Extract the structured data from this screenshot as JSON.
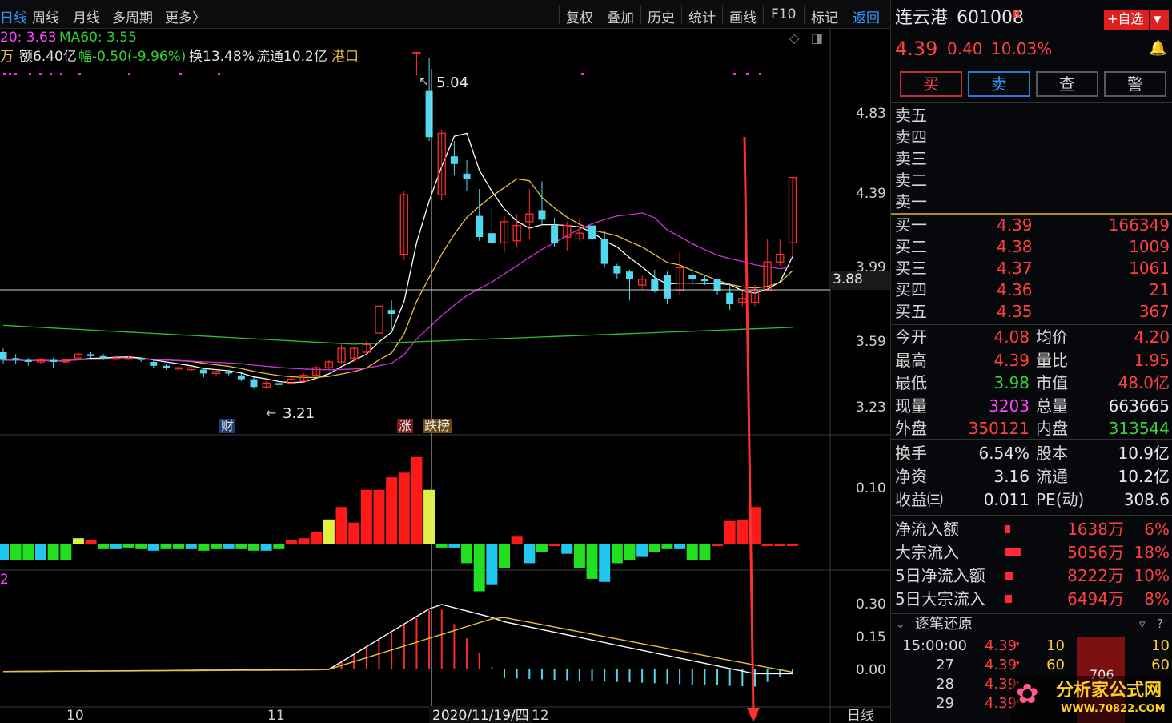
{
  "toolbar": {
    "tabs": [
      "日线",
      "周线",
      "月线",
      "多周期",
      "更多〉"
    ],
    "tools": [
      "复权",
      "叠加",
      "历史",
      "统计",
      "画线",
      "F10",
      "标记",
      "返回"
    ]
  },
  "info_line1": {
    "ma20": "20: 3.63",
    "ma60": "MA60: 3.55"
  },
  "info_line2": {
    "unit": "万",
    "amount": "额6.40亿",
    "change": "幅-0.50(-9.96%)",
    "turnover": "换13.48%",
    "float": "流通10.2亿",
    "sector": "港口"
  },
  "price_axis": [
    "4.83",
    "4.39",
    "3.99",
    "3.59",
    "3.23"
  ],
  "cursor_price": "3.88",
  "vol_axis": [
    "0.10"
  ],
  "macd_axis": [
    "0.30",
    "0.15",
    "0.00"
  ],
  "macd_label": "2",
  "annotations": {
    "high": "5.04",
    "low": "3.21",
    "tag_cai": "财",
    "tag_zhang": "涨",
    "tag_bang": "跌榜"
  },
  "date_axis": {
    "m10": "10",
    "m11": "11",
    "cursor_date": "2020/11/19/四",
    "m12": "12",
    "period": "日线"
  },
  "colors": {
    "up": "#ff2a2a",
    "down": "#4fd8f0",
    "ma5": "#ffffff",
    "ma10": "#e8c040",
    "ma20": "#d030e0",
    "ma60": "#30c030"
  },
  "stock": {
    "name": "连云港",
    "code": "601008",
    "badge": "R",
    "price": "4.39",
    "change": "0.40",
    "pct": "10.03%",
    "watch_button": "+自选"
  },
  "trade_buttons": [
    "买",
    "卖",
    "查",
    "警"
  ],
  "sells": [
    "卖五",
    "卖四",
    "卖三",
    "卖二",
    "卖一"
  ],
  "buys": [
    {
      "label": "买一",
      "price": "4.39",
      "vol": "166349"
    },
    {
      "label": "买二",
      "price": "4.38",
      "vol": "1009"
    },
    {
      "label": "买三",
      "price": "4.37",
      "vol": "1061"
    },
    {
      "label": "买四",
      "price": "4.36",
      "vol": "21"
    },
    {
      "label": "买五",
      "price": "4.35",
      "vol": "367"
    }
  ],
  "stats": [
    {
      "l1": "今开",
      "v1": "4.08",
      "l2": "均价",
      "v2": "4.20"
    },
    {
      "l1": "最高",
      "v1": "4.39",
      "l2": "量比",
      "v2": "1.95"
    },
    {
      "l1": "最低",
      "v1": "3.98",
      "l2": "市值",
      "v2": "48.0亿"
    },
    {
      "l1": "现量",
      "v1": "3203",
      "l2": "总量",
      "v2": "663665"
    },
    {
      "l1": "外盘",
      "v1": "350121",
      "l2": "内盘",
      "v2": "313544"
    }
  ],
  "stats2": [
    {
      "l1": "换手",
      "v1": "6.54%",
      "l2": "股本",
      "v2": "10.9亿"
    },
    {
      "l1": "净资",
      "v1": "3.16",
      "l2": "流通",
      "v2": "10.2亿"
    },
    {
      "l1": "收益㈢",
      "v1": "0.011",
      "l2": "PE(动)",
      "v2": "308.6"
    }
  ],
  "flows": [
    {
      "label": "净流入额",
      "value": "1638万",
      "pct": "6%",
      "fill": 0.06
    },
    {
      "label": "大宗流入",
      "value": "5056万",
      "pct": "18%",
      "fill": 0.18
    },
    {
      "label": "5日净流入额",
      "value": "8222万",
      "pct": "10%",
      "fill": 0.1
    },
    {
      "label": "5日大宗流入",
      "value": "6494万",
      "pct": "8%",
      "fill": 0.08
    }
  ],
  "ticks_title": "逐笔还原",
  "ticks": [
    {
      "time": "15:00:00",
      "price": "4.39",
      "vol": "10",
      "vol2": "10"
    },
    {
      "time": "27",
      "price": "4.39",
      "vol": "60",
      "vol2": "60"
    },
    {
      "time": "28",
      "price": "4.39",
      "vol": "",
      "vol2": ""
    },
    {
      "time": "29",
      "price": "4.39",
      "vol": "",
      "vol2": ""
    }
  ],
  "tick_block": "706",
  "watermark": {
    "cn": "分析家公式网",
    "url": "WWW.70822.COM"
  }
}
